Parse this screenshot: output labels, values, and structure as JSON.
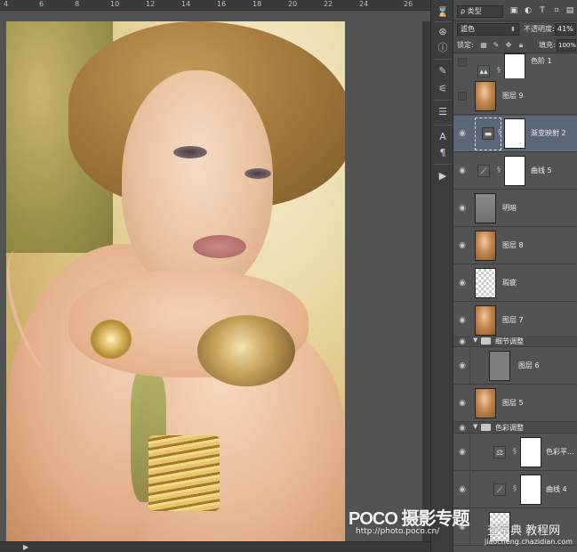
{
  "ruler": {
    "ticks": [
      "4",
      "6",
      "8",
      "10",
      "12",
      "14",
      "16",
      "18",
      "20",
      "22",
      "24",
      "26"
    ]
  },
  "layers_panel": {
    "filter": {
      "kind_label": "ρ 类型"
    },
    "blend_mode": "滤色",
    "opacity_label": "不透明度:",
    "opacity_value": "41%",
    "lock_label": "锁定:",
    "fill_label": "填充:",
    "fill_value": "100%",
    "layers": [
      {
        "name": "色阶 1",
        "kind": "adjustment",
        "icon": "levels-icon",
        "thumb": "white",
        "visible": false,
        "selected": false,
        "indent": false
      },
      {
        "name": "图层 9",
        "kind": "pixel",
        "thumb": "photo",
        "visible": false,
        "selected": false,
        "indent": false
      },
      {
        "name": "渐变映射 2",
        "kind": "adjustment",
        "icon": "gradient-map-icon",
        "thumb": "white",
        "visible": true,
        "selected": true,
        "indent": false
      },
      {
        "name": "曲线 5",
        "kind": "adjustment",
        "icon": "curves-icon",
        "thumb": "white",
        "visible": true,
        "selected": false,
        "indent": false
      },
      {
        "name": "明暗",
        "kind": "pixel",
        "thumb": "mapgray",
        "visible": true,
        "selected": false,
        "indent": false
      },
      {
        "name": "图层 8",
        "kind": "pixel",
        "thumb": "photo",
        "visible": true,
        "selected": false,
        "indent": false
      },
      {
        "name": "瑕疵",
        "kind": "pixel",
        "thumb": "transparent",
        "visible": true,
        "selected": false,
        "indent": false
      },
      {
        "name": "图层 7",
        "kind": "pixel",
        "thumb": "photo",
        "visible": true,
        "selected": false,
        "indent": false
      },
      {
        "name": "细节调整",
        "kind": "group",
        "visible": true
      },
      {
        "name": "图层 6",
        "kind": "pixel",
        "thumb": "gray",
        "visible": true,
        "selected": false,
        "indent": true
      },
      {
        "name": "图层 5",
        "kind": "pixel",
        "thumb": "photo",
        "visible": true,
        "selected": false,
        "indent": false
      },
      {
        "name": "色彩调整",
        "kind": "group",
        "visible": true
      },
      {
        "name": "色彩平...",
        "kind": "adjustment",
        "icon": "color-balance-icon",
        "thumb": "white",
        "visible": true,
        "selected": false,
        "indent": true
      },
      {
        "name": "曲线 4",
        "kind": "adjustment",
        "icon": "curves-icon",
        "thumb": "white",
        "visible": true,
        "selected": false,
        "indent": true
      },
      {
        "name": "",
        "kind": "pixel",
        "thumb": "transparent",
        "visible": true,
        "selected": false,
        "indent": true
      }
    ]
  },
  "watermark": {
    "poco": "POCO 摄影专题",
    "poco_url": "http://photo.poco.cn/",
    "site": "查字典 教程网",
    "site_url": "jiaocheng.chazidian.com"
  },
  "colors": {
    "selected_layer": "#5b6677",
    "panel_bg": "#535353"
  }
}
